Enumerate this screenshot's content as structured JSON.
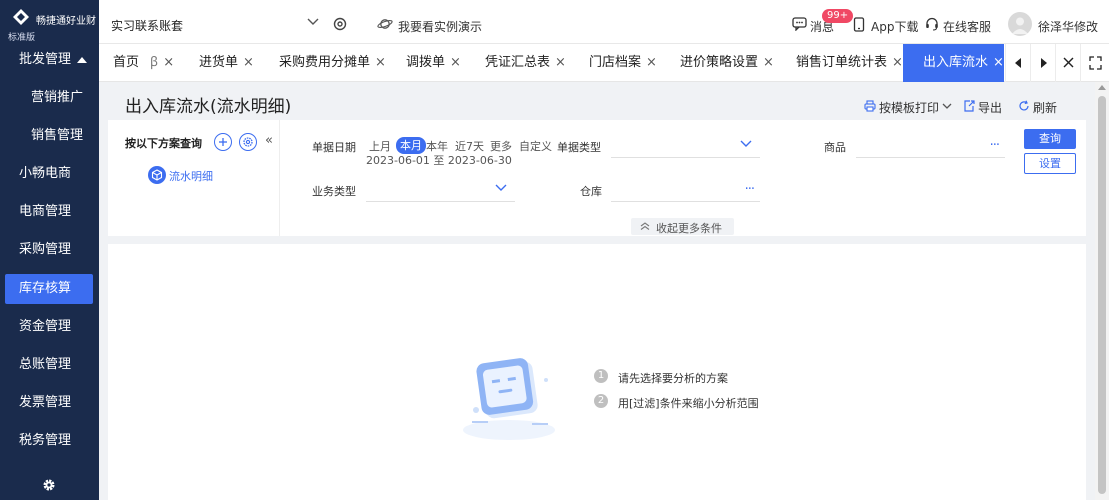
{
  "app": {
    "logo_name": "畅捷通好业财",
    "edition": "标准版"
  },
  "sidebar": {
    "items": [
      {
        "label": "批发管理"
      },
      {
        "label": "营销推广"
      },
      {
        "label": "销售管理"
      },
      {
        "label": "小畅电商"
      },
      {
        "label": "电商管理"
      },
      {
        "label": "采购管理"
      },
      {
        "label": "库存核算"
      },
      {
        "label": "资金管理"
      },
      {
        "label": "总账管理"
      },
      {
        "label": "发票管理"
      },
      {
        "label": "税务管理"
      }
    ],
    "active": "库存核算"
  },
  "topbar": {
    "account": "实习联系账套",
    "demo": "我要看实例演示",
    "messages": "消息",
    "badge": "99+",
    "app_download": "App下载",
    "support": "在线客服",
    "user": "徐泽华修改"
  },
  "tabs": {
    "items": [
      {
        "label": "首页"
      },
      {
        "label": "ꞵ"
      },
      {
        "label": "进货单"
      },
      {
        "label": "采购费用分摊单"
      },
      {
        "label": "调拨单"
      },
      {
        "label": "凭证汇总表"
      },
      {
        "label": "门店档案"
      },
      {
        "label": "进价策略设置"
      },
      {
        "label": "销售订单统计表"
      },
      {
        "label": "出入库流水"
      }
    ],
    "close": "×",
    "active": "出入库流水"
  },
  "page": {
    "title": "出入库流水(流水明细)",
    "actions": {
      "print": "按模板打印",
      "export": "导出",
      "refresh": "刷新"
    }
  },
  "filter": {
    "scheme_title": "按以下方案查询",
    "scheme_item": "流水明细",
    "labels": {
      "date": "单据日期",
      "doc_type": "单据类型",
      "product": "商品",
      "biz_type": "业务类型",
      "warehouse": "仓库"
    },
    "date_chips": [
      "上月",
      "本月",
      "本年",
      "近7天",
      "更多",
      "自定义"
    ],
    "date_chip_active": "本月",
    "date_range": "2023-06-01 至 2023-06-30",
    "ellipsis": "···",
    "query": "查询",
    "settings": "设置",
    "collapse_more": "收起更多条件"
  },
  "empty_state": {
    "hints": [
      {
        "num": "1",
        "text": "请先选择要分析的方案"
      },
      {
        "num": "2",
        "text": "用[过滤]条件来缩小分析范围"
      }
    ]
  },
  "colors": {
    "sidebar_bg": "#1a2b4c",
    "accent": "#3c6df0",
    "badge": "#f04864"
  }
}
